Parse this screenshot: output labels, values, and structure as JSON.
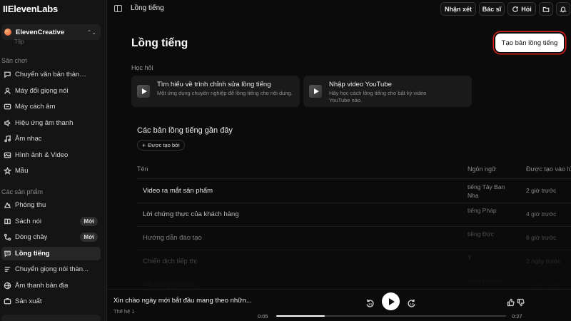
{
  "app": {
    "logo": "IIElevenLabs"
  },
  "workspace": {
    "name": "ElevenCreative"
  },
  "sidebar": {
    "cutoff_item": "Tập",
    "section_playground": "Sân chơi",
    "playground_items": [
      {
        "label": "Chuyển văn bản thành ...",
        "icon": "text-to-speech-icon"
      },
      {
        "label": "Máy đổi giọng nói",
        "icon": "voice-changer-icon"
      },
      {
        "label": "Máy cách âm",
        "icon": "voice-isolator-icon"
      },
      {
        "label": "Hiệu ứng âm thanh",
        "icon": "sound-effects-icon"
      },
      {
        "label": "Âm nhạc",
        "icon": "music-icon"
      },
      {
        "label": "Hình ảnh & Video",
        "icon": "image-video-icon"
      },
      {
        "label": "Mẫu",
        "icon": "templates-icon"
      }
    ],
    "section_products": "Các sản phẩm",
    "product_items": [
      {
        "label": "Phòng thu",
        "icon": "studio-icon",
        "badge": ""
      },
      {
        "label": "Sách nói",
        "icon": "audiobook-icon",
        "badge": "Mới"
      },
      {
        "label": "Dòng chảy",
        "icon": "flows-icon",
        "badge": "Mới"
      },
      {
        "label": "Lồng tiếng",
        "icon": "dubbing-icon",
        "badge": "",
        "active": true
      },
      {
        "label": "Chuyển giọng nói thàn...",
        "icon": "speech-to-text-icon",
        "badge": ""
      },
      {
        "label": "Âm thanh bản địa",
        "icon": "localized-audio-icon",
        "badge": ""
      },
      {
        "label": "Sản xuất",
        "icon": "productions-icon",
        "badge": ""
      }
    ]
  },
  "topbar": {
    "title": "Lồng tiếng",
    "feedback_label": "Nhận xét",
    "docs_label": "Bác sĩ",
    "ask_label": "Hỏi"
  },
  "main": {
    "title": "Lồng tiếng",
    "create_label": "Tạo bản lồng tiếng",
    "learn_title": "Học hỏi",
    "cards": [
      {
        "title": "Tìm hiểu về trình chỉnh sửa lồng tiếng",
        "desc": "Một ứng dụng chuyên nghiệp để lồng tiếng cho nội dung."
      },
      {
        "title": "Nhập video YouTube",
        "desc": "Hãy học cách lồng tiếng cho bất kỳ video YouTube nào."
      }
    ],
    "recent_title": "Các bản lồng tiếng gần đây",
    "filter_label": "Được tạo bởi",
    "columns": {
      "name": "Tên",
      "language": "Ngôn ngữ",
      "created": "Được tạo vào lú"
    },
    "rows": [
      {
        "name": "Video ra mắt sản phẩm",
        "language": "tiếng Tây Ban Nha",
        "created": "2 giờ trước"
      },
      {
        "name": "Lời chứng thực của khách hàng",
        "language": "tiếng Pháp",
        "created": "4 giờ trước"
      },
      {
        "name": "Hướng dẫn đào tạo",
        "language": "tiếng Đức",
        "created": "6 giờ trước"
      },
      {
        "name": "Chiến dịch tiếp thị",
        "language": "Ý",
        "created": "2 ngày trước"
      },
      {
        "name": "Nội dung giáo dục",
        "language": "tiếng Bồ Đào",
        "created": "3 ngày trước"
      }
    ]
  },
  "player": {
    "title": "Xin chào ngày mới bắt đầu mang theo nhữn...",
    "subtitle": "Thế hệ 1",
    "current_time": "0:05",
    "duration": "0:27",
    "progress": 0.21
  }
}
